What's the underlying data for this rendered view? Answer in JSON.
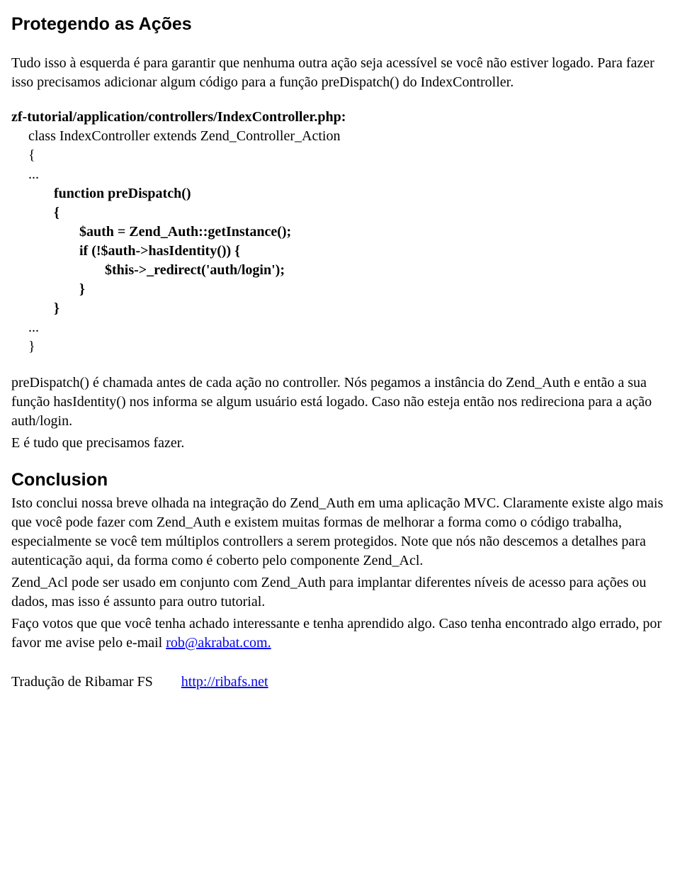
{
  "heading1": "Protegendo as Ações",
  "intro": "Tudo isso à esquerda é para garantir que nenhuma outra ação seja acessível se você não estiver logado. Para fazer isso precisamos adicionar algum código para a função preDispatch() do IndexController.",
  "file_label": "zf-tutorial/application/controllers/IndexController.php:",
  "code": {
    "l1": "class IndexController extends Zend_Controller_Action",
    "l2": "{",
    "l3": "...",
    "l4": "function preDispatch()",
    "l5": "{",
    "l6": "$auth = Zend_Auth::getInstance();",
    "l7": "if (!$auth->hasIdentity()) {",
    "l8": "$this->_redirect('auth/login');",
    "l9": "}",
    "l10": "}",
    "l11": "...",
    "l12": "}"
  },
  "explain1": "preDispatch() é chamada antes de cada ação no controller. Nós pegamos a instância do Zend_Auth e então a sua função hasIdentity() nos informa se algum usuário está logado. Caso não esteja então nos redireciona para a ação auth/login.",
  "explain2": "E é tudo que precisamos fazer.",
  "heading2": "Conclusion",
  "conclusion1": "Isto conclui nossa breve olhada na integração do Zend_Auth em uma aplicação MVC. Claramente existe algo mais que você pode fazer com Zend_Auth e existem muitas formas de melhorar a forma como o código trabalha, especialmente se você tem múltiplos controllers a serem protegidos. Note que nós não descemos a detalhes para autenticação aqui, da forma como é coberto pelo componente Zend_Acl.",
  "conclusion2": "Zend_Acl pode ser usado em conjunto com Zend_Auth para implantar diferentes níveis de acesso para ações ou dados, mas isso é assunto para outro tutorial.",
  "conclusion3_pre": "Faço votos que que você tenha achado interessante e tenha aprendido algo. Caso tenha encontrado algo errado, por favor me avise pelo e-mail ",
  "email_link": "rob@akrabat.com.",
  "footer_pre": "Tradução de Ribamar FS",
  "footer_link": "http://ribafs.net"
}
